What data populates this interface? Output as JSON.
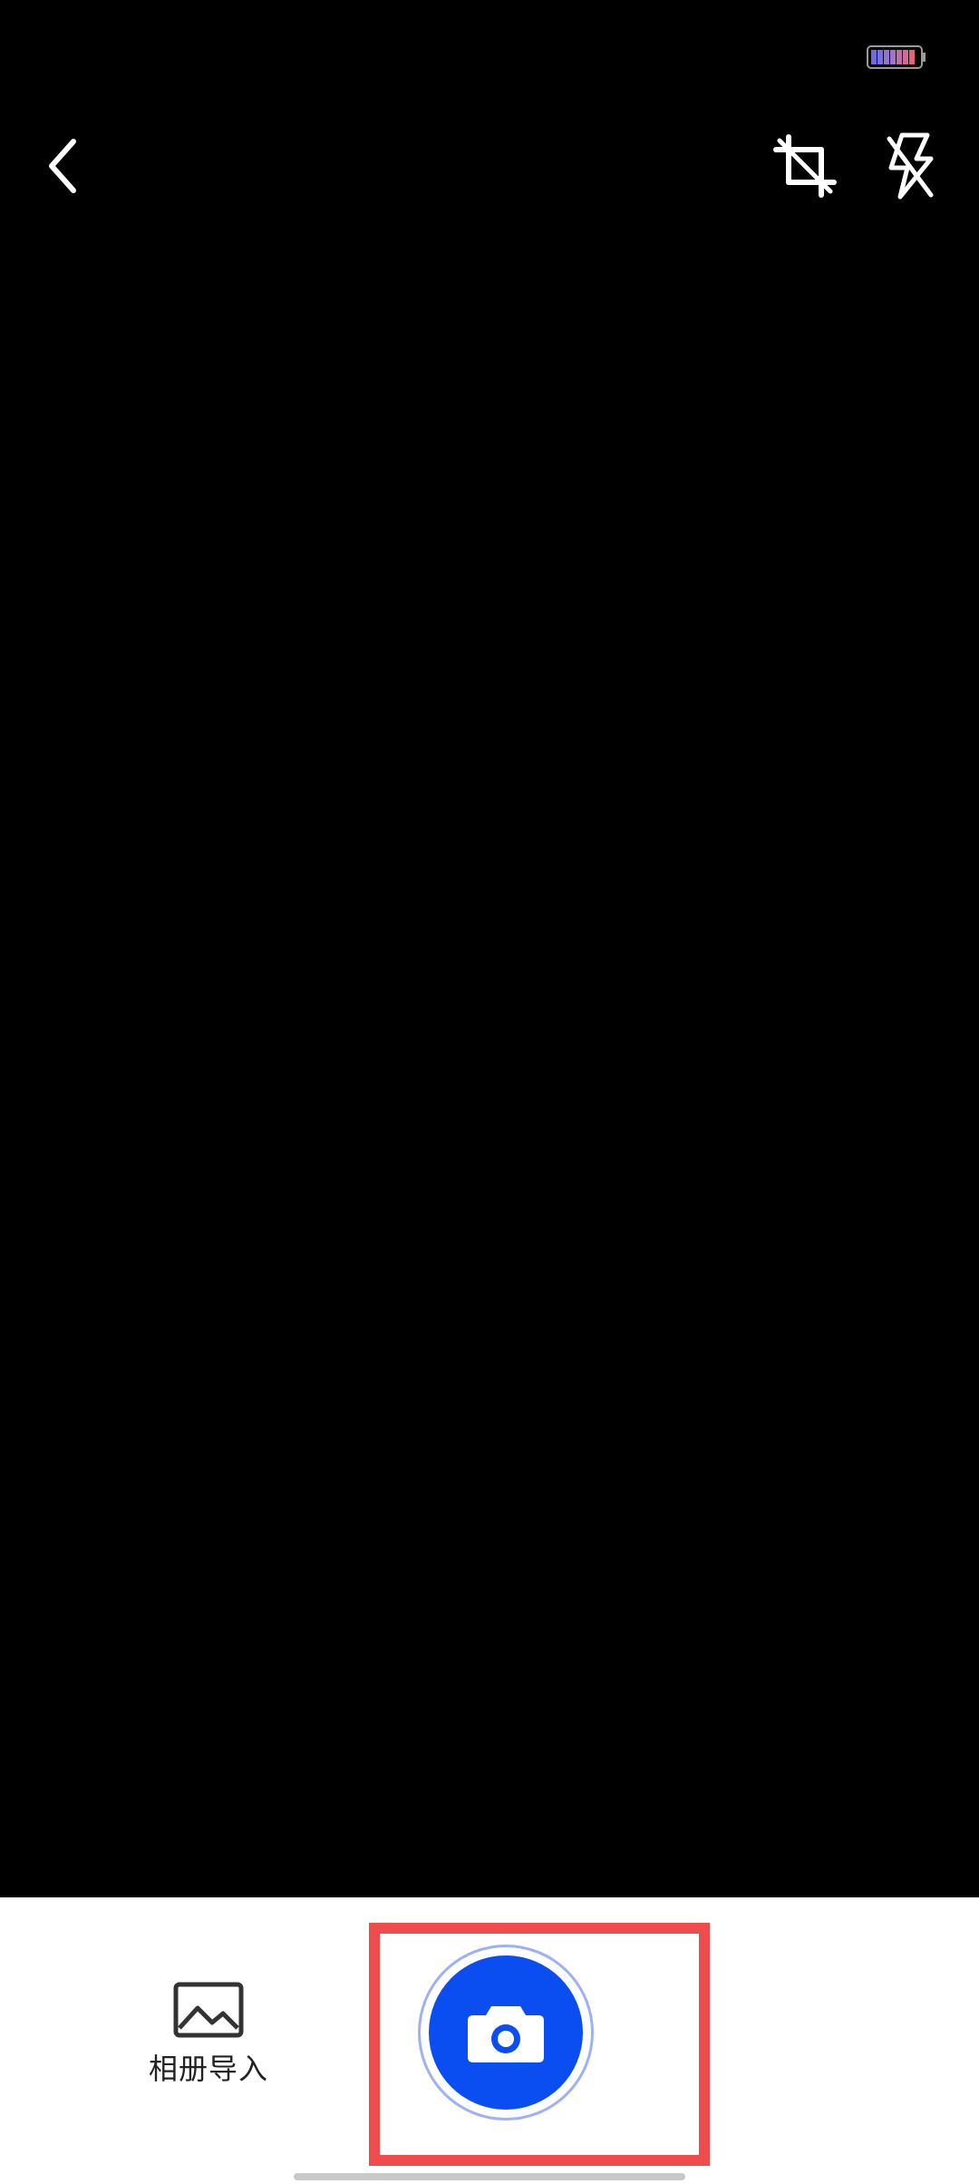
{
  "status_bar": {
    "battery_icon": "battery-icon"
  },
  "toolbar": {
    "back_icon": "chevron-left-icon",
    "crop_icon": "crop-icon",
    "flash_icon": "flash-off-icon"
  },
  "bottom_panel": {
    "album_import_label": "相册导入",
    "album_icon": "image-icon",
    "shutter_icon": "camera-icon"
  },
  "colors": {
    "accent": "#0a4ef2",
    "highlight": "#ef4d4d",
    "background": "#000000",
    "panel": "#ffffff"
  }
}
